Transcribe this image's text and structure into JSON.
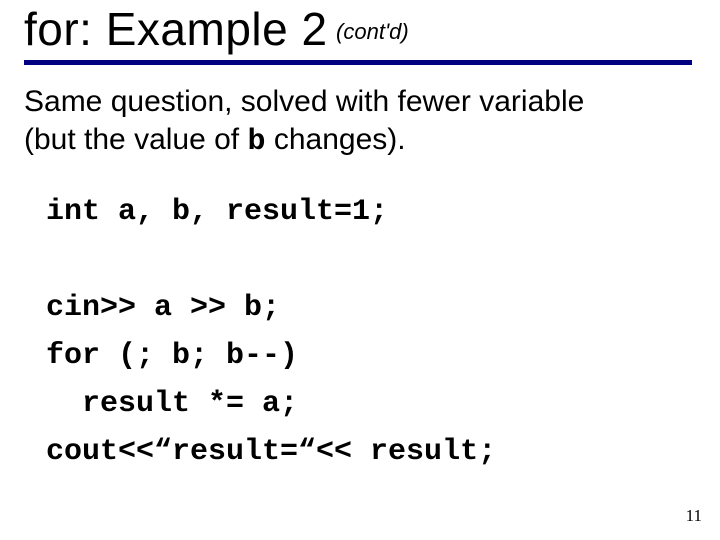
{
  "title": {
    "main": "for: Example 2",
    "sub": "(cont'd)"
  },
  "body": {
    "line1": "Same question, solved with fewer variable",
    "line2_pre": "(but the value of ",
    "line2_code": "b",
    "line2_post": " changes)."
  },
  "code": {
    "l1": "int a, b, result=1;",
    "l2": "",
    "l3": "cin>> a >> b;",
    "l4": "for (; b; b--)",
    "l5": "  result *= a;",
    "l6": "cout<<“result=“<< result;"
  },
  "page_number": "11"
}
